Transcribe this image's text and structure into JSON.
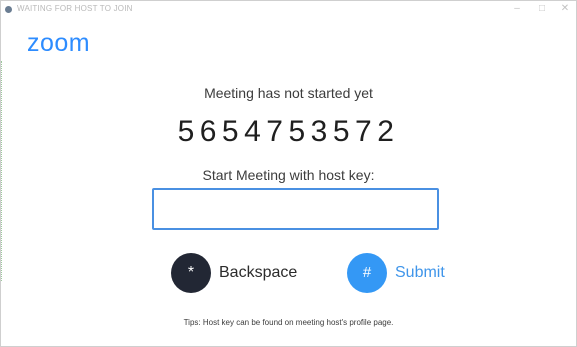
{
  "window": {
    "title": "WAITING FOR HOST TO JOIN",
    "controls": {
      "minimize": "–",
      "maximize": "□",
      "close": "✕"
    },
    "icon": "zoom-app-icon"
  },
  "brand": {
    "logo_text": "zoom",
    "color": "#2d8cff"
  },
  "main": {
    "status_text": "Meeting has not started yet",
    "meeting_id": "5654753572",
    "host_key_label": "Start Meeting with host key:",
    "host_key_value": "",
    "host_key_placeholder": ""
  },
  "buttons": {
    "backspace": {
      "symbol": "*",
      "label": "Backspace",
      "icon": "asterisk-icon",
      "color": "#222734"
    },
    "submit": {
      "symbol": "#",
      "label": "Submit",
      "icon": "hash-icon",
      "color": "#3498f5"
    }
  },
  "footer": {
    "tips": "Tips: Host key can be found on meeting host's profile page."
  }
}
